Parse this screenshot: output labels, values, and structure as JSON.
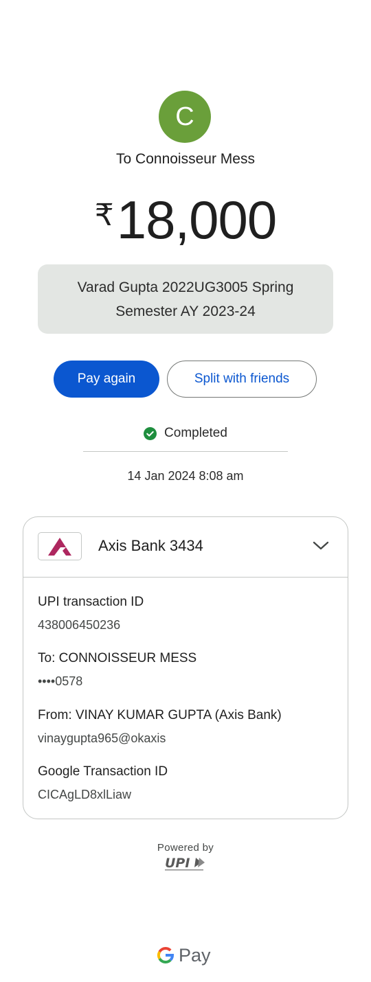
{
  "payee": {
    "initial": "C",
    "label": "To Connoisseur Mess",
    "avatar_color": "#6a9f3a"
  },
  "amount": {
    "currency_symbol": "₹",
    "value": "18,000"
  },
  "note": "Varad Gupta 2022UG3005 Spring Semester AY 2023-24",
  "actions": {
    "pay_again": "Pay again",
    "split": "Split with friends"
  },
  "status": {
    "label": "Completed",
    "icon": "check-circle-icon",
    "color": "#1e8e3e"
  },
  "datetime": "14 Jan 2024 8:08 am",
  "account": {
    "bank_name": "Axis Bank 3434",
    "logo": "axis-bank-logo",
    "expand_icon": "chevron-down-icon"
  },
  "details": [
    {
      "label": "UPI transaction ID",
      "value": "438006450236"
    },
    {
      "label": "To: CONNOISSEUR MESS",
      "value": "••••0578"
    },
    {
      "label": "From: VINAY KUMAR GUPTA (Axis Bank)",
      "value": "vinaygupta965@okaxis"
    },
    {
      "label": "Google Transaction ID",
      "value": "CICAgLD8xlLiaw"
    }
  ],
  "footer": {
    "powered_by": "Powered by",
    "upi_logo": "upi-logo",
    "brand": "Pay",
    "brand_icon": "google-g-icon"
  },
  "colors": {
    "primary": "#0b57d0",
    "axis_brand": "#ae275f"
  }
}
